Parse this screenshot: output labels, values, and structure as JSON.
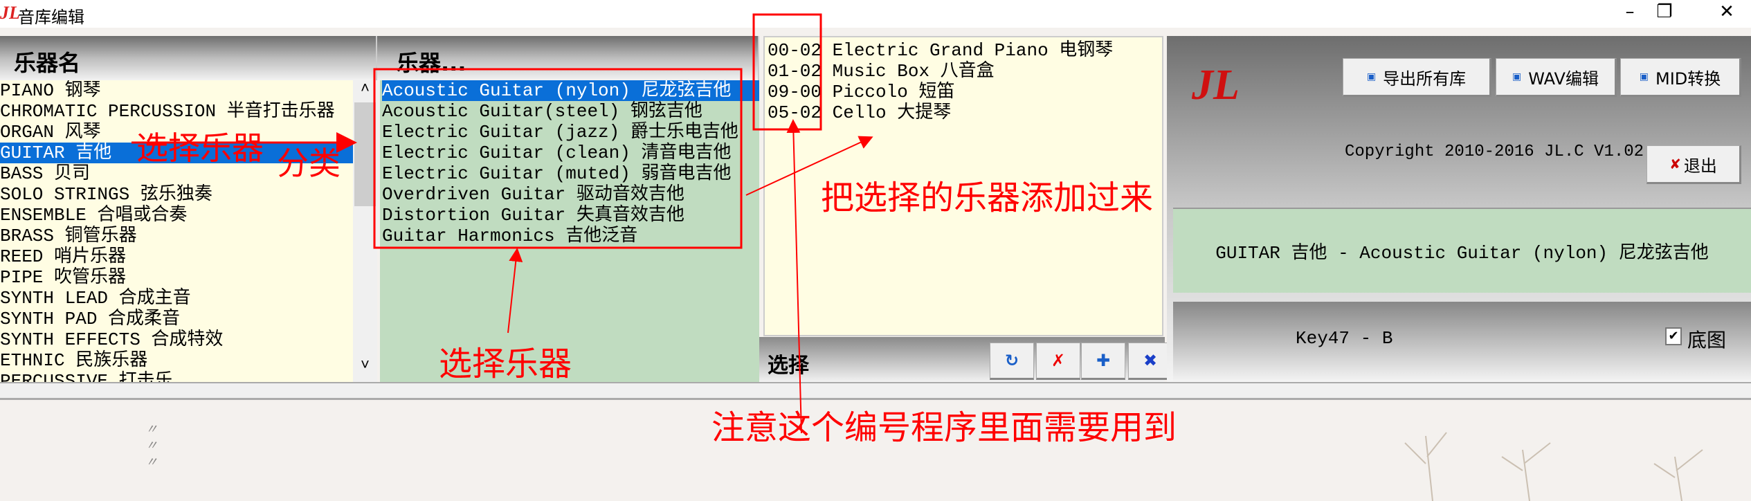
{
  "window": {
    "title": "音库编辑",
    "app_icon": "JL",
    "minimize": "–",
    "restore": "❐",
    "close": "✕"
  },
  "left_panel": {
    "header": "乐器名",
    "items": [
      "PIANO 钢琴",
      "CHROMATIC PERCUSSION 半音打击乐器",
      "ORGAN 风琴",
      "GUITAR 吉他",
      "BASS 贝司",
      "SOLO STRINGS 弦乐独奏",
      "ENSEMBLE 合唱或合奏",
      "BRASS 铜管乐器",
      "REED 哨片乐器",
      "PIPE 吹管乐器",
      "SYNTH LEAD 合成主音",
      "SYNTH PAD 合成柔音",
      "SYNTH EFFECTS 合成特效",
      "ETHNIC 民族乐器",
      "PERCUSSIVE 打击乐"
    ],
    "selected_index": 3,
    "scroll_up": "˄",
    "scroll_down": "˅"
  },
  "middle_panel": {
    "header": "乐器...",
    "items": [
      "Acoustic Guitar (nylon) 尼龙弦吉他",
      "Acoustic Guitar(steel) 钢弦吉他",
      "Electric Guitar (jazz) 爵士乐电吉他",
      "Electric Guitar (clean) 清音电吉他",
      "Electric Guitar (muted) 弱音电吉他",
      "Overdriven Guitar 驱动音效吉他",
      "Distortion Guitar 失真音效吉他",
      "Guitar Harmonics 吉他泛音"
    ],
    "selected_index": 0
  },
  "selected_panel": {
    "items": [
      {
        "code": "00-02",
        "name": "Electric Grand Piano 电钢琴"
      },
      {
        "code": "01-02",
        "name": "Music Box 八音盒"
      },
      {
        "code": "09-00",
        "name": "Piccolo 短笛"
      },
      {
        "code": "05-02",
        "name": "Cello 大提琴"
      }
    ],
    "label": "选择",
    "tool_buttons": [
      "↻",
      "✗",
      "✚",
      "✖"
    ]
  },
  "right_panel": {
    "logo": "JL",
    "export_all": "导出所有库",
    "wav_edit": "WAV编辑",
    "mid_convert": "MID转换",
    "copyright": "Copyright 2010-2016 JL.C V1.02",
    "exit": "退出",
    "exit_icon": "✘",
    "current": "GUITAR 吉他 - Acoustic Guitar (nylon) 尼龙弦吉他",
    "key": "Key47 - B",
    "background_checkbox": "底图",
    "background_checked": true
  },
  "annotations": {
    "select_category_a": "选择乐器",
    "select_category_b": "分类",
    "select_instrument": "选择乐器",
    "add_selected": "把选择的乐器添加过来",
    "note_code": "注意这个编号程序里面需要用到"
  }
}
